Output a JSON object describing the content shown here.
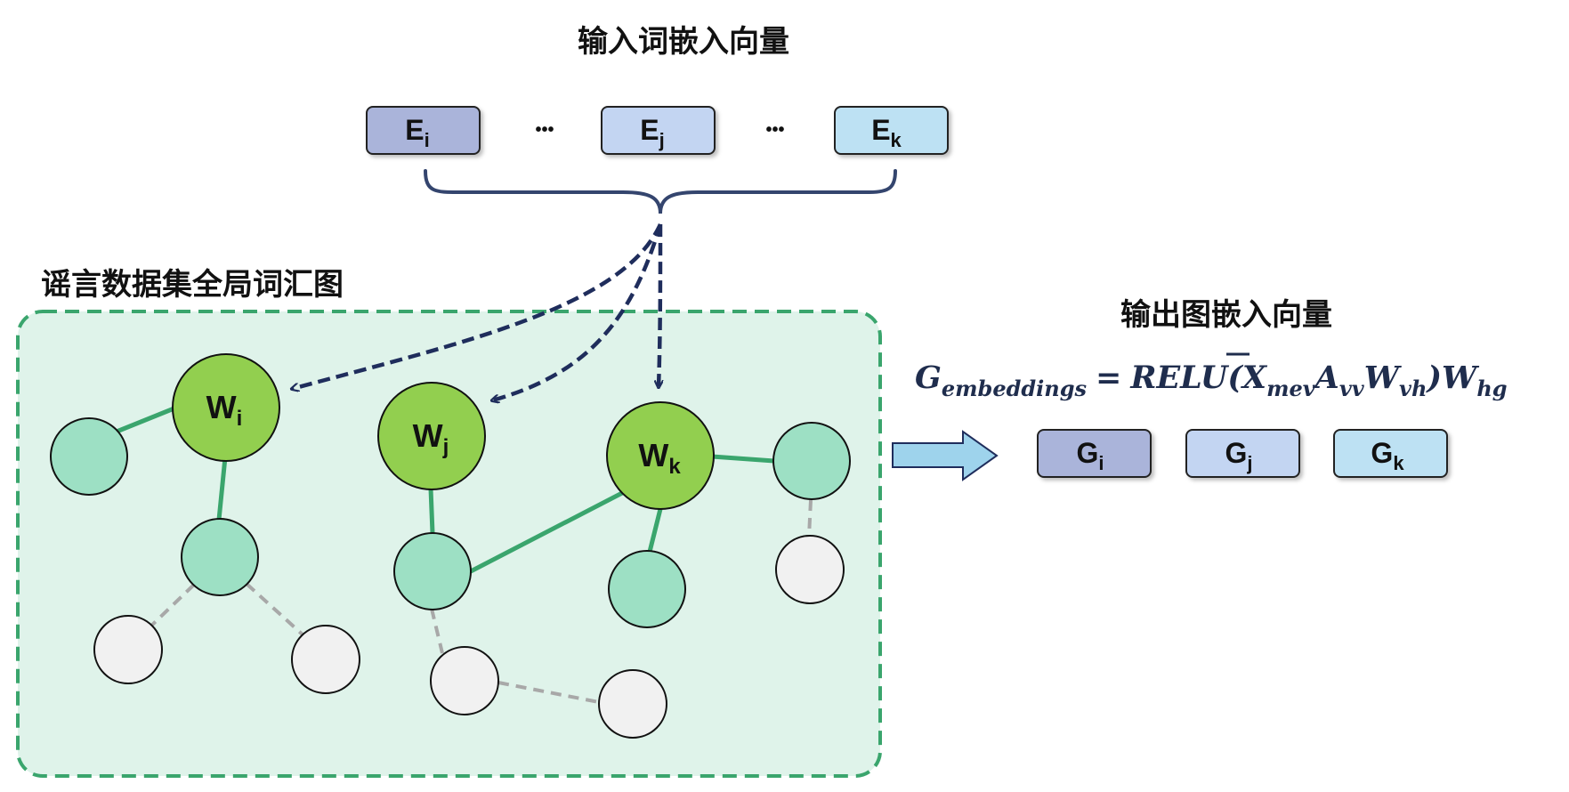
{
  "titles": {
    "input_embeddings": "输入词嵌入向量",
    "global_graph": "谣言数据集全局词汇图",
    "output_embeddings": "输出图嵌入向量"
  },
  "input_boxes": [
    {
      "main": "E",
      "sub": "i",
      "color": "#aab4da"
    },
    {
      "main": "E",
      "sub": "j",
      "color": "#c3d5f2"
    },
    {
      "main": "E",
      "sub": "k",
      "color": "#bde1f3"
    }
  ],
  "ellipsis": "•••",
  "word_nodes": [
    {
      "main": "W",
      "sub": "i"
    },
    {
      "main": "W",
      "sub": "j"
    },
    {
      "main": "W",
      "sub": "k"
    }
  ],
  "formula": {
    "lhs_main": "G",
    "lhs_sub": "embeddings",
    "eq": "=",
    "relu": "RELU(",
    "x_main": "X",
    "x_sub": "mev",
    "a_main": "A",
    "a_sub": "vv",
    "w1_main": "W",
    "w1_sub": "vh",
    "close": ")",
    "w2_main": "W",
    "w2_sub": "hg"
  },
  "output_boxes": [
    {
      "main": "G",
      "sub": "i",
      "color": "#aab4da"
    },
    {
      "main": "G",
      "sub": "j",
      "color": "#c3d5f2"
    },
    {
      "main": "G",
      "sub": "k",
      "color": "#bde1f3"
    }
  ],
  "colors": {
    "word_node": "#92cf4f",
    "neighbor_node": "#9de0c4",
    "other_node": "#f1f1f1",
    "graph_border": "#3aa56d",
    "graph_fill": "#dff3ea",
    "edge_solid": "#3aa56d",
    "edge_dashed": "#a8a8a8",
    "arrow": "#1f2d5c",
    "brace": "#34456e",
    "block_arrow": "#9ed3ec"
  }
}
